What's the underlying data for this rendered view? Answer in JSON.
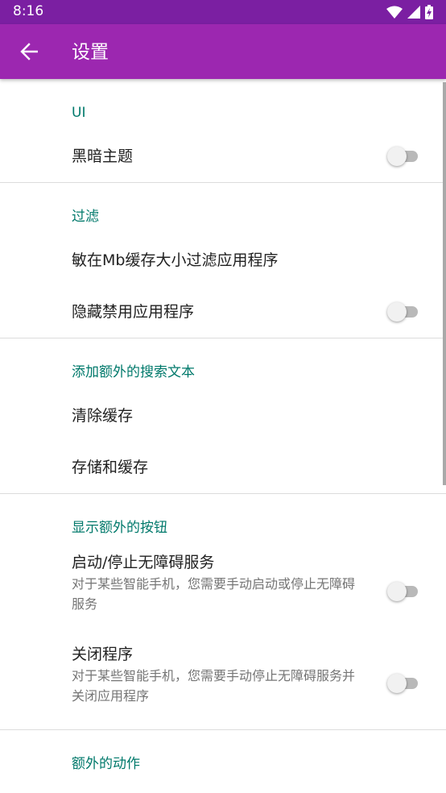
{
  "status_bar": {
    "time": "8:16"
  },
  "app_bar": {
    "title": "设置"
  },
  "sections": {
    "ui": {
      "header": "UI",
      "dark_theme": {
        "title": "黑暗主题",
        "enabled": false
      }
    },
    "filter": {
      "header": "过滤",
      "cache_size": {
        "title": "敏在Mb缓存大小过滤应用程序"
      },
      "hide_disabled": {
        "title": "隐藏禁用应用程序",
        "enabled": false
      }
    },
    "search": {
      "header": "添加额外的搜索文本",
      "clear_cache": {
        "title": "清除缓存"
      },
      "storage": {
        "title": "存储和缓存"
      }
    },
    "buttons": {
      "header": "显示额外的按钮",
      "accessibility": {
        "title": "启动/停止无障碍服务",
        "summary": "对于某些智能手机，您需要手动启动或停止无障碍服务",
        "enabled": false
      },
      "close_app": {
        "title": "关闭程序",
        "summary": "对于某些智能手机，您需要手动停止无障碍服务并关闭应用程序",
        "enabled": false
      }
    },
    "actions": {
      "header": "额外的动作"
    }
  },
  "colors": {
    "status_bar": "#7b1fa2",
    "app_bar": "#9c27b0",
    "section_header": "#00796b"
  },
  "icons": {
    "back": "arrow-back-icon",
    "wifi": "wifi-icon",
    "signal": "signal-icon",
    "battery": "battery-charging-icon"
  }
}
